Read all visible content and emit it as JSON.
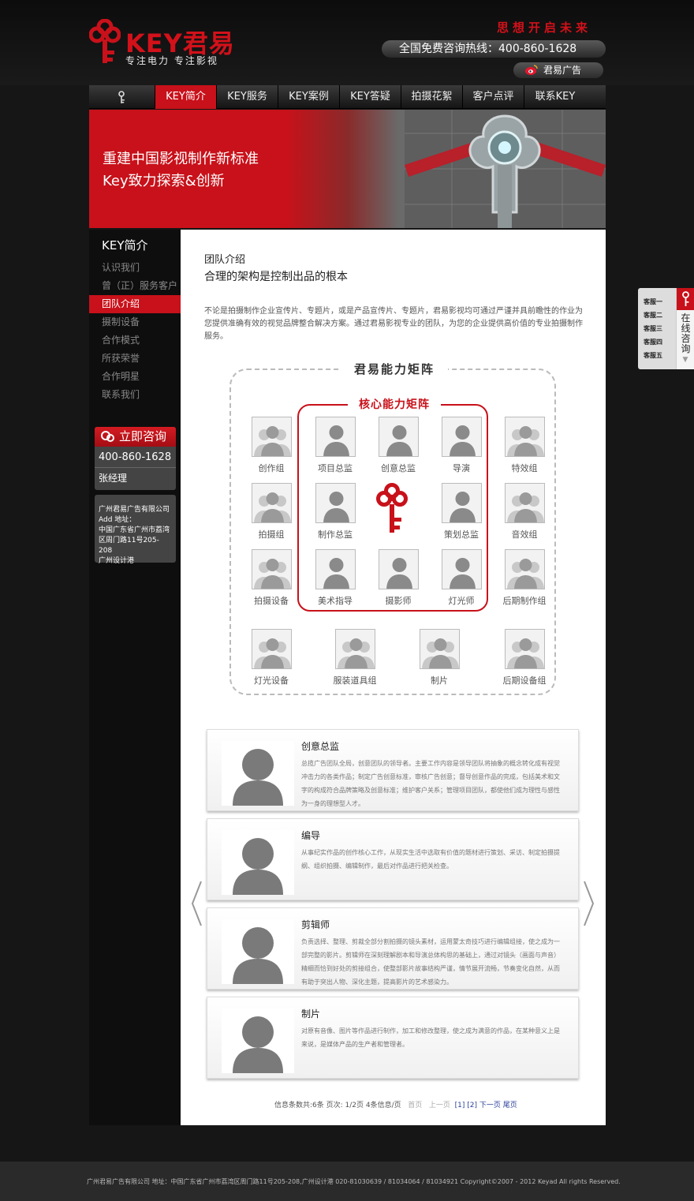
{
  "header": {
    "logo_text": "KEY君易",
    "slogan": "专注电力 专注影视",
    "motto": "思想开启未来",
    "hotline": "全国免费咨询热线：400-860-1628",
    "weibo_label": "君易广告"
  },
  "nav": {
    "items": [
      "KEY简介",
      "KEY服务",
      "KEY案例",
      "KEY答疑",
      "拍摄花絮",
      "客户点评",
      "联系KEY"
    ]
  },
  "banner": {
    "line1": "重建中国影视制作新标准",
    "line2": "Key致力探索&创新"
  },
  "sidebar": {
    "title": "KEY简介",
    "items": [
      "认识我们",
      "曾（正）服务客户",
      "团队介绍",
      "摄制设备",
      "合作模式",
      "所获荣誉",
      "合作明星",
      "联系我们"
    ],
    "consult_title": "立即咨询",
    "phone": "400-860-1628",
    "contact": "张经理",
    "address_lines": [
      "广州君易广告有限公司",
      "Add 地址：",
      "中国广东省广州市荔湾",
      "区周门路11号205-208",
      "广州设计港"
    ]
  },
  "main": {
    "title1": "团队介绍",
    "title2": "合理的架构是控制出品的根本",
    "intro": "不论是拍摄制作企业宣传片、专题片，或是产品宣传片、专题片，君易影视均可通过严谨并具前瞻性的作业为您提供准确有效的视觉品牌整合解决方案。通过君易影视专业的团队，为您的企业提供高价值的专业拍摄制作服务。",
    "matrix_title": "君易能力矩阵",
    "core_title": "核心能力矩阵",
    "members": [
      "创作组",
      "项目总监",
      "创意总监",
      "导演",
      "特效组",
      "拍摄组",
      "制作总监",
      "策划总监",
      "音效组",
      "拍摄设备",
      "美术指导",
      "摄影师",
      "灯光师",
      "后期制作组",
      "灯光设备",
      "服装道具组",
      "制片",
      "后期设备组"
    ],
    "cards": [
      {
        "role": "创意总监",
        "desc": "总揽广告团队全局，创意团队的领导者。主要工作内容是领导团队将抽象的概念转化成有视觉冲击力的各类作品；制定广告创意标准，审核广告创意；督导创意作品的完成，包括美术和文字的构成符合品牌策略及创意标准；维护客户关系；管理项目团队，都使他们成为理性与感性为一身的理想型人才。"
      },
      {
        "role": "编导",
        "desc": "从事纪实作品的创作核心工作，从现实生活中选取有价值的题材进行策划、采访、制定拍摄提纲、组织拍摄、编辑制作，最后对作品进行把关检查。"
      },
      {
        "role": "剪辑师",
        "desc": "负责选择、整理、剪裁全部分割拍摄的镜头素材，运用蒙太奇技巧进行编辑组接，使之成为一部完整的影片。剪辑师在深刻理解剧本和导演总体构思的基础上，通过对镜头（画面与声音）精细而恰到好处的剪接组合，使整部影片故事结构严谨，情节展开流畅，节奏变化自然，从而有助于突出人物、深化主题，提高影片的艺术感染力。"
      },
      {
        "role": "制片",
        "desc": "对原有音像、图片等作品进行制作，加工和修改整理，使之成为满意的作品，在某种意义上是来说，是媒体产品的生产者和管理者。"
      }
    ],
    "pager": {
      "info": "信息条数共:6条  页次: 1/2页  4条信息/页",
      "first": "首页",
      "prev": "上一页",
      "p1": "[1]",
      "p2": "[2]",
      "next": "下一页",
      "last": "尾页"
    }
  },
  "float": {
    "items": [
      "客服一",
      "客服二",
      "客服三",
      "客服四",
      "客服五"
    ],
    "label": "在线咨询"
  },
  "footer": {
    "text": "广州君易广告有限公司   地址：中国广东省广州市荔湾区周门路11号205-208,广州设计港     020-81030639 / 81034064 / 81034921    Copyright©2007 - 2012 Keyad  All rights Reserved."
  },
  "colors": {
    "brand_red": "#c8111a",
    "dark_bg": "#161616"
  },
  "icons": [
    "key-icon",
    "weibo-icon",
    "chat-icon",
    "avatar-icon",
    "chevron-left-icon",
    "chevron-right-icon"
  ]
}
